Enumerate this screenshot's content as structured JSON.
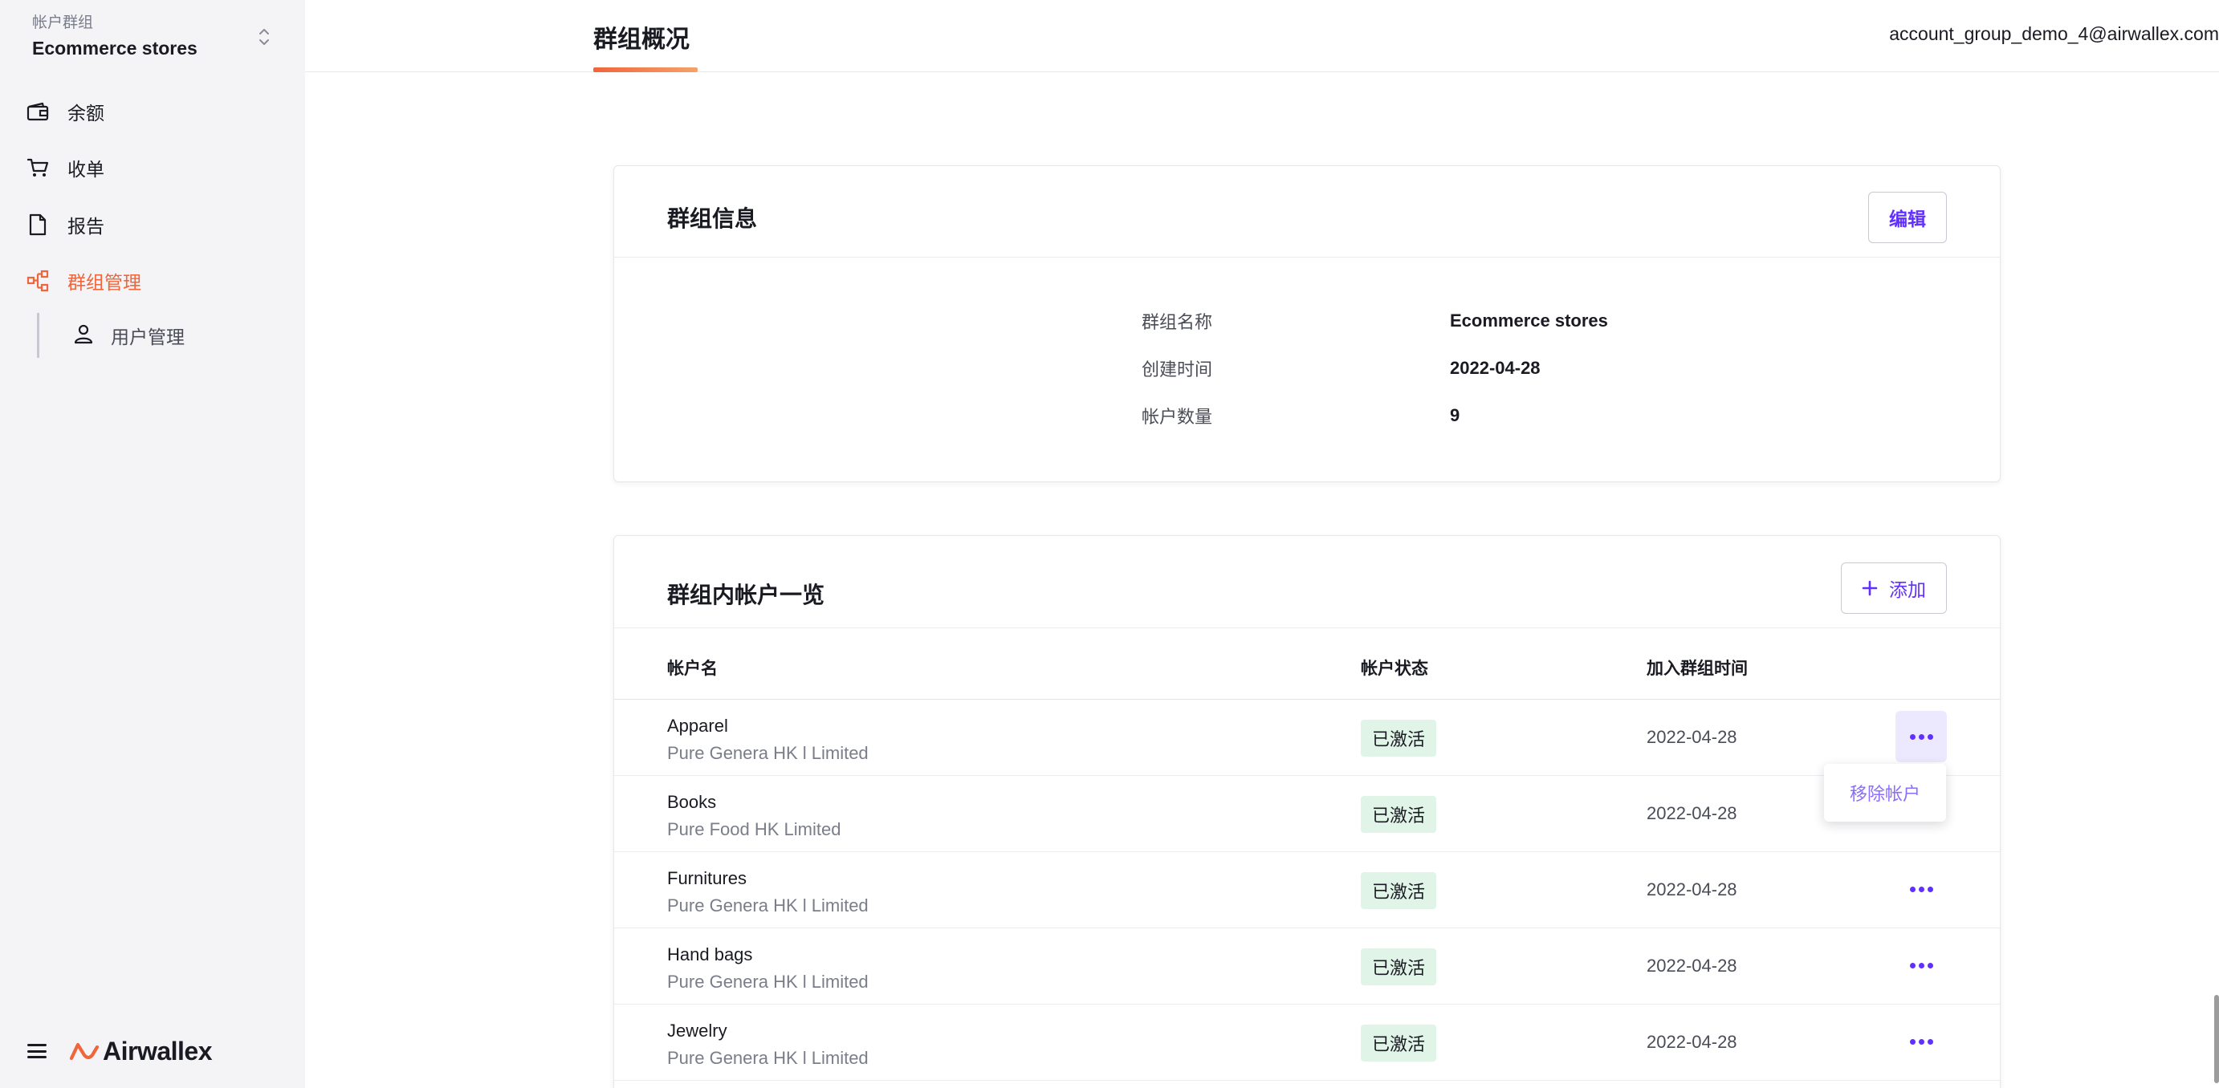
{
  "sidebar": {
    "account_group_label": "帐户群组",
    "account_group_name": "Ecommerce stores",
    "nav": [
      {
        "label": "余额",
        "icon": "wallet-icon"
      },
      {
        "label": "收单",
        "icon": "cart-icon"
      },
      {
        "label": "报告",
        "icon": "document-icon"
      },
      {
        "label": "群组管理",
        "icon": "org-hierarchy-icon",
        "active": true
      }
    ],
    "sub_nav": [
      {
        "label": "用户管理",
        "icon": "user-icon"
      }
    ],
    "brand": "Airwallex"
  },
  "header": {
    "page_title": "群组概况",
    "user_email": "account_group_demo_4@airwallex.com"
  },
  "group_info": {
    "title": "群组信息",
    "edit_label": "编辑",
    "fields": [
      {
        "key": "群组名称",
        "value": "Ecommerce stores"
      },
      {
        "key": "创建时间",
        "value": "2022-04-28"
      },
      {
        "key": "帐户数量",
        "value": "9"
      }
    ]
  },
  "accounts": {
    "title": "群组内帐户一览",
    "add_label": "添加",
    "columns": [
      "帐户名",
      "帐户状态",
      "加入群组时间"
    ],
    "rows": [
      {
        "name": "Apparel",
        "entity": "Pure Genera HK l Limited",
        "status": "已激活",
        "joined": "2022-04-28"
      },
      {
        "name": "Books",
        "entity": "Pure Food HK Limited",
        "status": "已激活",
        "joined": "2022-04-28"
      },
      {
        "name": "Furnitures",
        "entity": "Pure Genera HK l Limited",
        "status": "已激活",
        "joined": "2022-04-28"
      },
      {
        "name": "Hand bags",
        "entity": "Pure Genera HK l Limited",
        "status": "已激活",
        "joined": "2022-04-28"
      },
      {
        "name": "Jewelry",
        "entity": "Pure Genera HK l Limited",
        "status": "已激活",
        "joined": "2022-04-28"
      }
    ],
    "row_menu": {
      "remove_label": "移除帐户"
    }
  },
  "colors": {
    "accent": "#f0653b",
    "primary": "#612fff",
    "status_bg": "#e0f4e8"
  }
}
